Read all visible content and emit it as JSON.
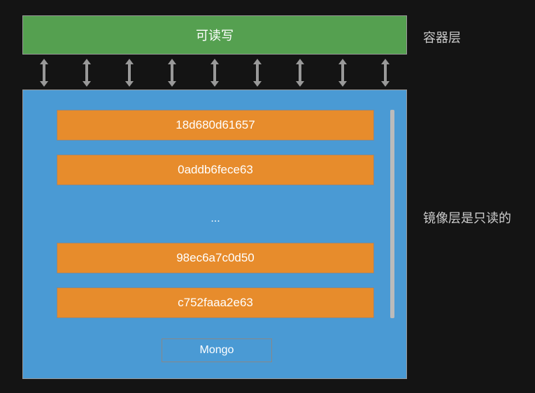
{
  "containerLayer": {
    "text": "可读写",
    "label": "容器层"
  },
  "imageBox": {
    "layers": {
      "l1": "18d680d61657",
      "l2": "0addb6fece63",
      "ellipsis": "...",
      "l3": "98ec6a7c0d50",
      "l4": "c752faaa2e63"
    },
    "name": "Mongo",
    "label": "镜像层是只读的"
  }
}
